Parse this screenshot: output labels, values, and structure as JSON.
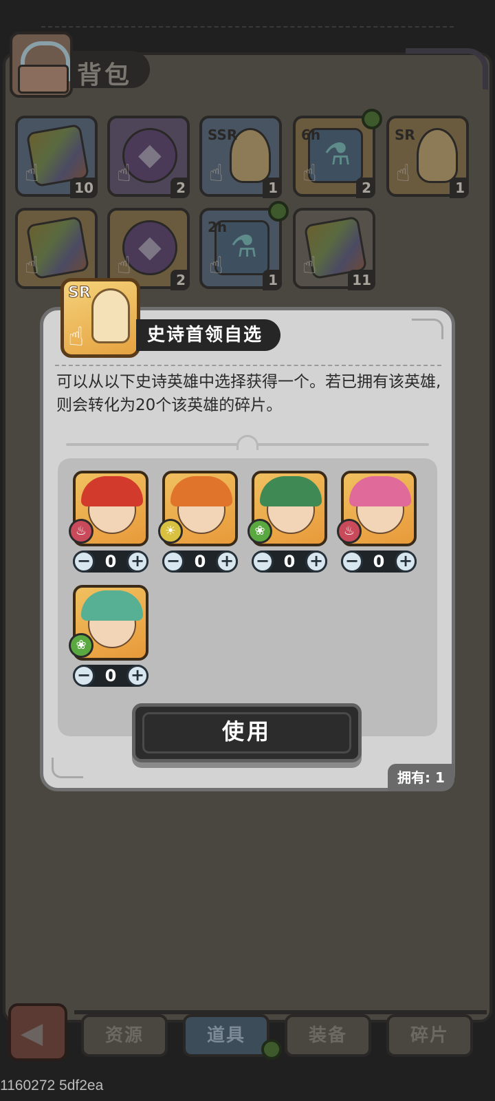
{
  "background": {
    "title": "背包",
    "items": [
      {
        "art": "book",
        "count": "10",
        "tag": "",
        "dot": false,
        "style": "blue"
      },
      {
        "art": "stone",
        "count": "2",
        "tag": "",
        "dot": false,
        "style": "purple"
      },
      {
        "art": "head",
        "count": "1",
        "tag": "SSR",
        "dot": false,
        "style": "blue"
      },
      {
        "art": "potion",
        "count": "2",
        "tag": "6h",
        "dot": true,
        "style": "gold"
      },
      {
        "art": "head",
        "count": "1",
        "tag": "SR",
        "dot": false,
        "style": "gold"
      },
      {
        "art": "book",
        "count": "",
        "tag": "",
        "dot": false,
        "style": "gold"
      },
      {
        "art": "stone",
        "count": "2",
        "tag": "",
        "dot": false,
        "style": "gold"
      },
      {
        "art": "potion",
        "count": "1",
        "tag": "2h",
        "dot": true,
        "style": "blue"
      },
      {
        "art": "book",
        "count": "11",
        "tag": "",
        "dot": false,
        "style": "gray"
      }
    ],
    "tabs": [
      "资源",
      "道具",
      "装备",
      "碎片"
    ],
    "active_tab": "道具",
    "footer_id": "1160272 5df2ea"
  },
  "modal": {
    "icon_tag": "SR",
    "title": "史诗首领自选",
    "description": "可以从以下史诗英雄中选择获得一个。若已拥有该英雄,则会转化为20个该英雄的碎片。",
    "heroes": [
      {
        "quantity": "0",
        "element": "fire",
        "hair_color": "#d23a2c",
        "frame_color": "#f0c060",
        "element_color": "#c94a5a"
      },
      {
        "quantity": "0",
        "element": "light",
        "hair_color": "#e0742a",
        "frame_color": "#f0c060",
        "element_color": "#d8c040"
      },
      {
        "quantity": "0",
        "element": "wind",
        "hair_color": "#3f8a54",
        "frame_color": "#f0c060",
        "element_color": "#5aa840"
      },
      {
        "quantity": "0",
        "element": "fire",
        "hair_color": "#e06a9a",
        "frame_color": "#f0c060",
        "element_color": "#c94a5a"
      },
      {
        "quantity": "0",
        "element": "wind",
        "hair_color": "#58b094",
        "frame_color": "#f0c060",
        "element_color": "#5aa840"
      }
    ],
    "use_label": "使用",
    "owned_label": "拥有: 1"
  },
  "colors": {
    "accent_dot": "#3e5a2c",
    "modal_bg": "#d3d3d3",
    "button_bg": "#2c2c2c"
  }
}
